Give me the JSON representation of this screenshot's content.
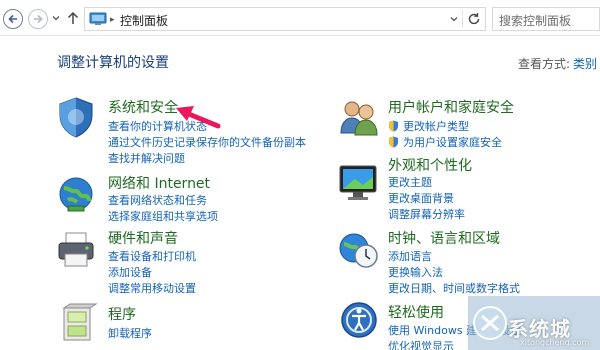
{
  "address": {
    "path": "控制面板",
    "separator": "▸"
  },
  "search": {
    "placeholder": "搜索控制面板"
  },
  "header": {
    "title": "调整计算机的设置",
    "view_label": "查看方式:",
    "view_value": "类别"
  },
  "categories": [
    {
      "title": "系统和安全",
      "links": [
        "查看你的计算机状态",
        "通过文件历史记录保存你的文件备份副本",
        "查找并解决问题"
      ]
    },
    {
      "title": "网络和 Internet",
      "links": [
        "查看网络状态和任务",
        "选择家庭组和共享选项"
      ]
    },
    {
      "title": "硬件和声音",
      "links": [
        "查看设备和打印机",
        "添加设备",
        "调整常用移动设置"
      ]
    },
    {
      "title": "程序",
      "links": [
        "卸载程序"
      ]
    },
    {
      "title": "用户帐户和家庭安全",
      "links": [
        "更改帐户类型",
        "为用户设置家庭安全"
      ]
    },
    {
      "title": "外观和个性化",
      "links": [
        "更改主题",
        "更改桌面背景",
        "调整屏幕分辨率"
      ]
    },
    {
      "title": "时钟、语言和区域",
      "links": [
        "添加语言",
        "更换输入法",
        "更改日期、时间或数字格式"
      ]
    },
    {
      "title": "轻松使用",
      "links": [
        "使用 Windows 建议的设置",
        "优化视觉显示"
      ]
    }
  ],
  "watermark": {
    "text": "系统城",
    "sub": "xitongcheng.com"
  },
  "colors": {
    "accent": "#1463b8",
    "category": "#1e6b1f",
    "title": "#1a3f7a",
    "arrow": "#e8185a"
  },
  "icons": [
    "back-arrow-icon",
    "forward-arrow-icon",
    "up-arrow-icon",
    "control-panel-icon",
    "refresh-icon",
    "shield-icon",
    "system-security-icon",
    "network-globe-icon",
    "printer-icon",
    "programs-box-icon",
    "users-icon",
    "monitor-icon",
    "clock-globe-icon",
    "accessibility-icon"
  ]
}
